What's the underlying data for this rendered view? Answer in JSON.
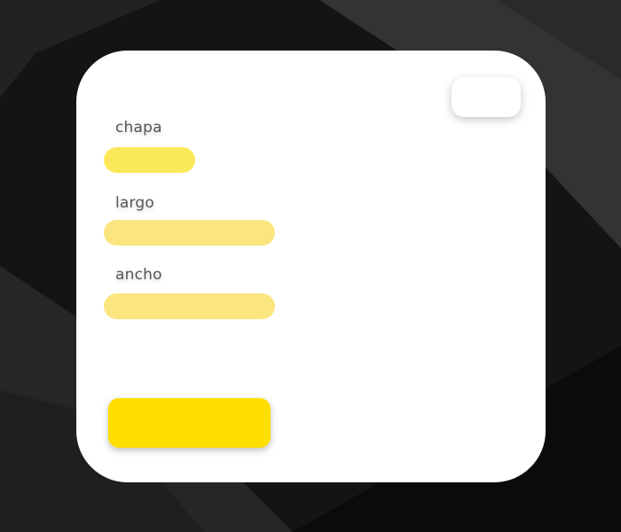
{
  "form": {
    "corner_button_label": "",
    "fields": [
      {
        "label": "chapa",
        "value": "",
        "placeholder": ""
      },
      {
        "label": "largo",
        "value": "",
        "placeholder": ""
      },
      {
        "label": "ancho",
        "value": "",
        "placeholder": ""
      }
    ],
    "submit_label": ""
  },
  "colors": {
    "background": "#141414",
    "card": "#ffffff",
    "input_active": "#fbe85a",
    "input": "#fbe57f",
    "submit": "#ffdf00"
  }
}
